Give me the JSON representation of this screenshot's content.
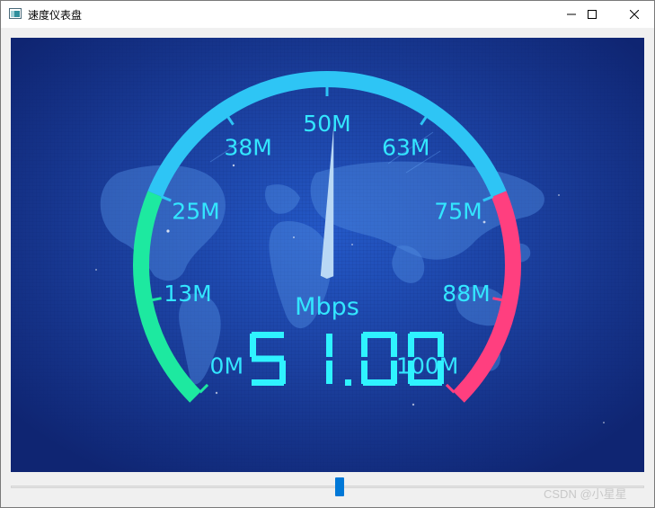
{
  "window": {
    "title": "速度仪表盘",
    "controls": {
      "minimize": "minimize",
      "maximize": "maximize",
      "close": "close"
    }
  },
  "gauge": {
    "unit": "Mbps",
    "value": 51,
    "value_text": "51.00",
    "min": 0,
    "max": 100,
    "tick_labels": [
      "0M",
      "13M",
      "25M",
      "38M",
      "50M",
      "63M",
      "75M",
      "88M",
      "100M"
    ],
    "colors": {
      "low": "#1de9a0",
      "mid": "#2ec5f5",
      "high": "#ff3f7f",
      "text": "#33e6ff",
      "digits": "#2ff3ff",
      "needle": "#b9d8f5",
      "background_center": "#2459c8",
      "background_edge": "#0f2572"
    }
  },
  "slider": {
    "value_fraction": 0.52
  },
  "watermark": "CSDN @小星星"
}
